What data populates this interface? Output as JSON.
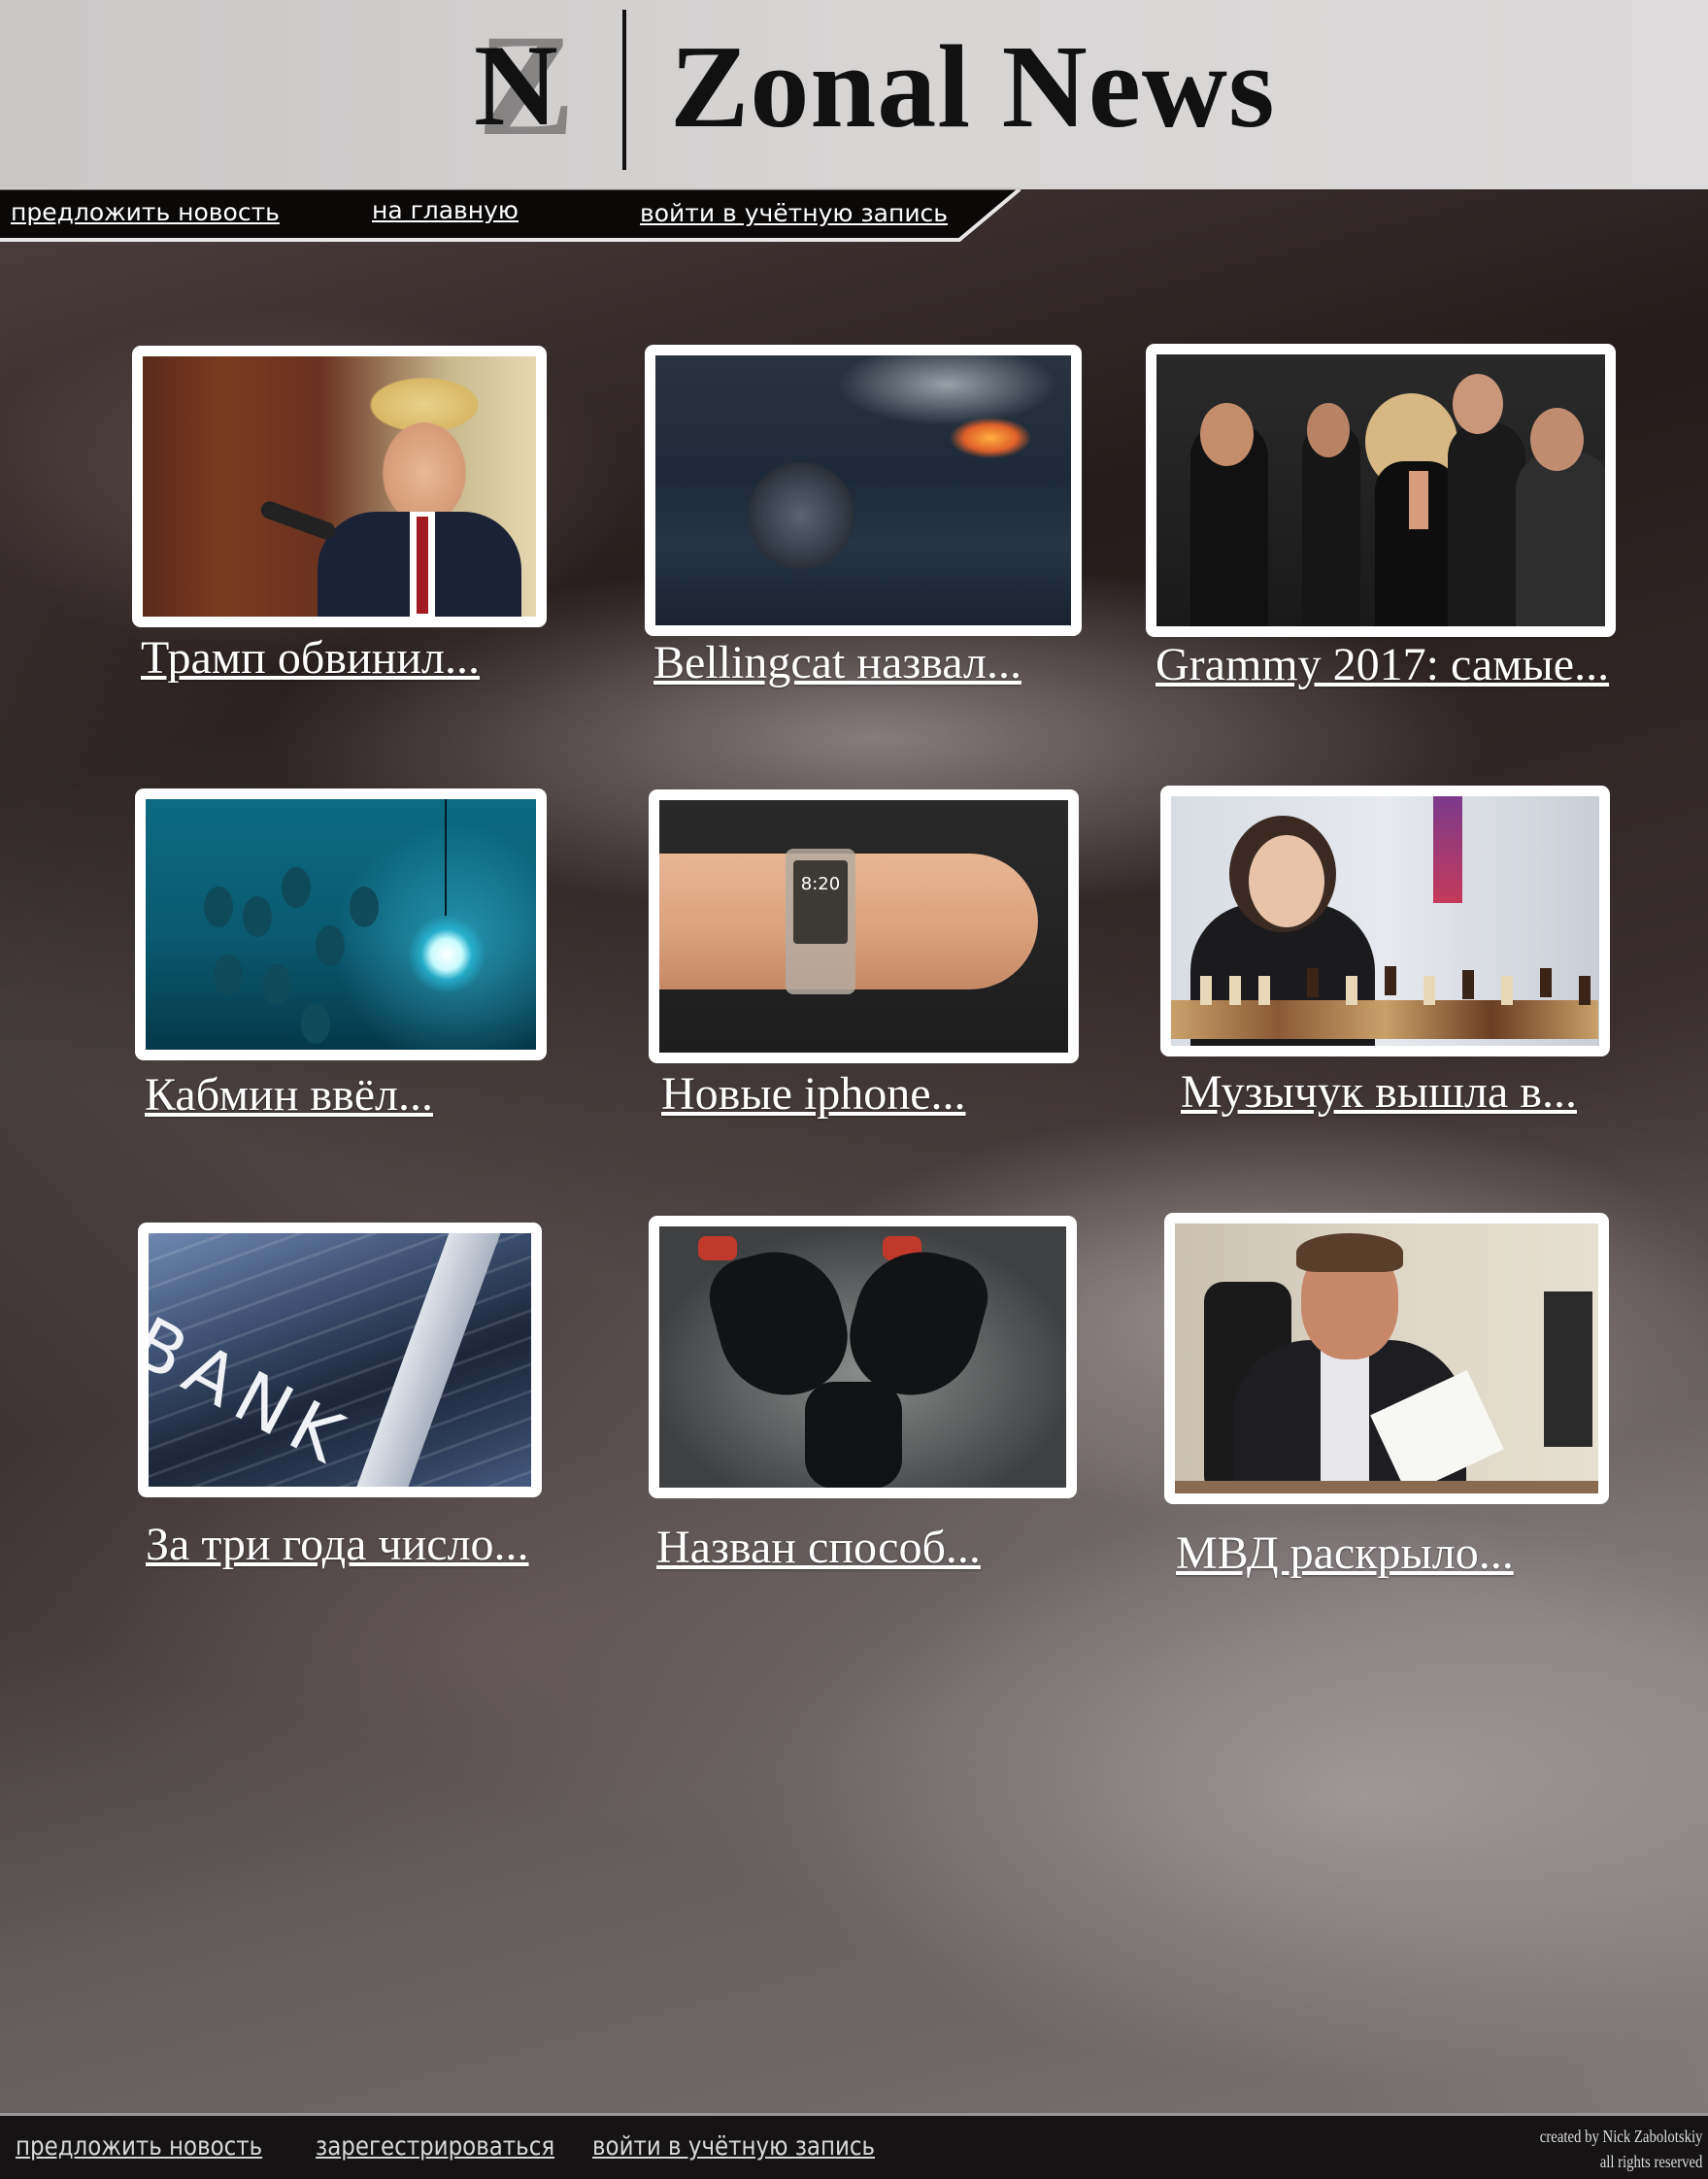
{
  "header": {
    "logo_letters": "ZN",
    "brand": "Zonal News"
  },
  "top_nav": {
    "suggest": "предложить новость",
    "home": "на главную",
    "login": "войти в учётную запись"
  },
  "news": [
    {
      "title": "Трамп обвинил...",
      "image": "trump-press-photo"
    },
    {
      "title": "Bellingcat назвал...",
      "image": "plane-wreckage-engine-photo"
    },
    {
      "title": "Grammy 2017: самые...",
      "image": "grammy-band-photo"
    },
    {
      "title": "Кабмин ввёл...",
      "image": "lightbulbs-photo"
    },
    {
      "title": "Новые iphone...",
      "image": "smartwatch-wrist-photo",
      "watch_time": "8:20"
    },
    {
      "title": "Музычук вышла в...",
      "image": "chess-player-photo"
    },
    {
      "title": "За три года число...",
      "image": "bank-building-photo",
      "sign": "BANK"
    },
    {
      "title": "Назван способ...",
      "image": "oil-gloves-photo"
    },
    {
      "title": "МВД раскрыло...",
      "image": "official-at-desk-photo"
    }
  ],
  "footer": {
    "suggest": "предложить новость",
    "register": "зарегестрироваться",
    "login": "войти в учётную запись",
    "credit_line1": "created by Nick Zabolotskiy",
    "credit_line2": "all rights reserved"
  },
  "colors": {
    "header_bg": "#d4d1d1",
    "footer_bg": "#151313",
    "link": "#ffffff"
  }
}
